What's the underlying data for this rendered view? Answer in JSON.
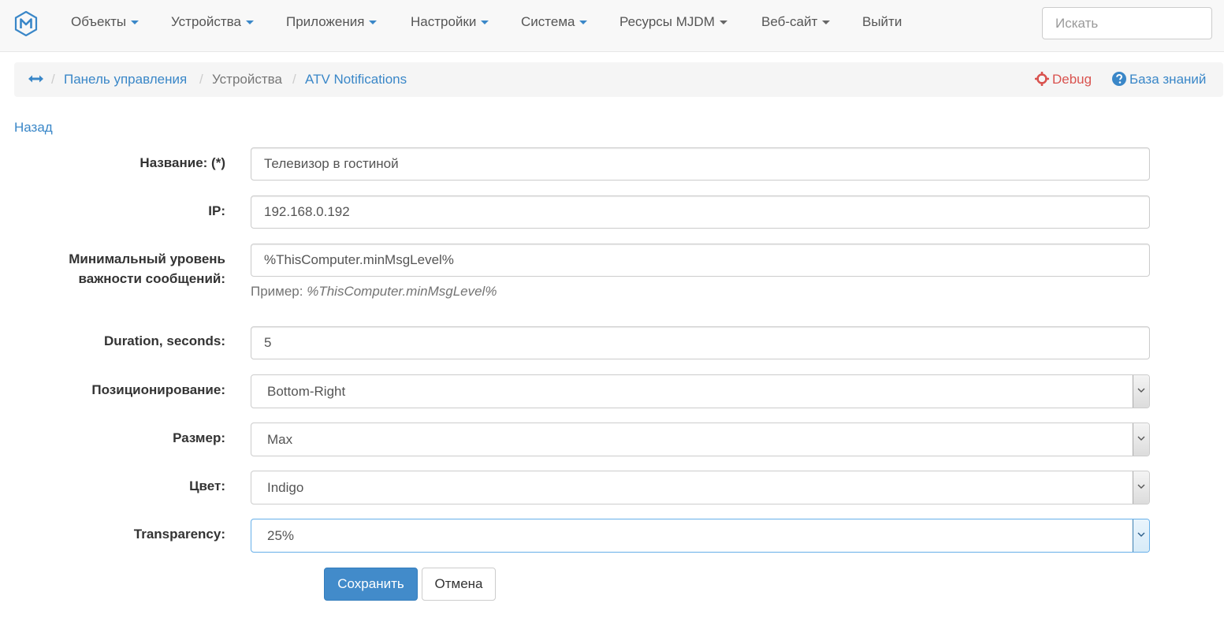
{
  "nav": {
    "items": [
      {
        "label": "Объекты",
        "dropdown": true
      },
      {
        "label": "Устройства",
        "dropdown": true
      },
      {
        "label": "Приложения",
        "dropdown": true
      },
      {
        "label": "Настройки",
        "dropdown": true
      },
      {
        "label": "Система",
        "dropdown": true
      },
      {
        "label": "Ресурсы MJDM",
        "dropdown": true
      },
      {
        "label": "Веб-сайт",
        "dropdown": true
      },
      {
        "label": "Выйти",
        "dropdown": false
      }
    ],
    "search_placeholder": "Искать"
  },
  "breadcrumb": {
    "home": "Панель управления",
    "section": "Устройства",
    "current": "ATV Notifications",
    "debug": "Debug",
    "knowledge_base": "База знаний"
  },
  "back": "Назад",
  "form": {
    "name": {
      "label": "Название: (*)",
      "value": "Телевизор в гостиной"
    },
    "ip": {
      "label": "IP:",
      "value": "192.168.0.192"
    },
    "min_level": {
      "label_line1": "Минимальный уровень",
      "label_line2": "важности сообщений:",
      "value": "%ThisComputer.minMsgLevel%",
      "help_prefix": "Пример: ",
      "help_example": "%ThisComputer.minMsgLevel%"
    },
    "duration": {
      "label": "Duration, seconds:",
      "value": "5"
    },
    "position": {
      "label": "Позиционирование:",
      "value": "Bottom-Right"
    },
    "size": {
      "label": "Размер:",
      "value": "Max"
    },
    "color": {
      "label": "Цвет:",
      "value": "Indigo"
    },
    "transparency": {
      "label": "Transparency:",
      "value": "25%"
    }
  },
  "buttons": {
    "save": "Сохранить",
    "cancel": "Отмена"
  },
  "colors": {
    "link": "#3a87c8",
    "primary": "#428bca",
    "debug": "#d9534f"
  }
}
